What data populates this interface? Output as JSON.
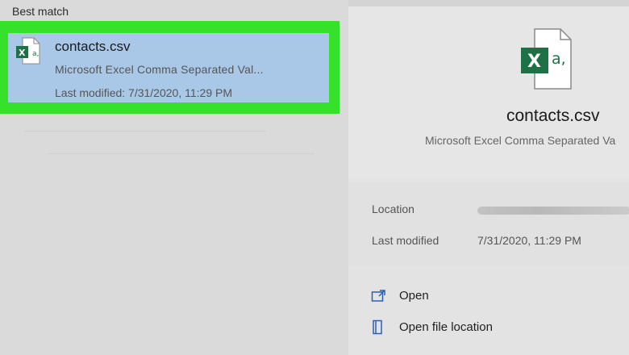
{
  "left": {
    "section_label": "Best match",
    "result": {
      "name": "contacts.csv",
      "type": "Microsoft Excel Comma Separated Val...",
      "modified": "Last modified: 7/31/2020, 11:29 PM"
    }
  },
  "preview": {
    "name": "contacts.csv",
    "type": "Microsoft Excel Comma Separated Va",
    "info": {
      "location_label": "Location",
      "modified_label": "Last modified",
      "modified_value": "7/31/2020, 11:29 PM"
    },
    "actions": [
      {
        "label": "Open",
        "icon": "open-icon"
      },
      {
        "label": "Open file location",
        "icon": "file-location-icon"
      }
    ]
  },
  "colors": {
    "highlight": "#35e12b",
    "selection": "#a9c8e7",
    "excel_green": "#1e7145"
  }
}
